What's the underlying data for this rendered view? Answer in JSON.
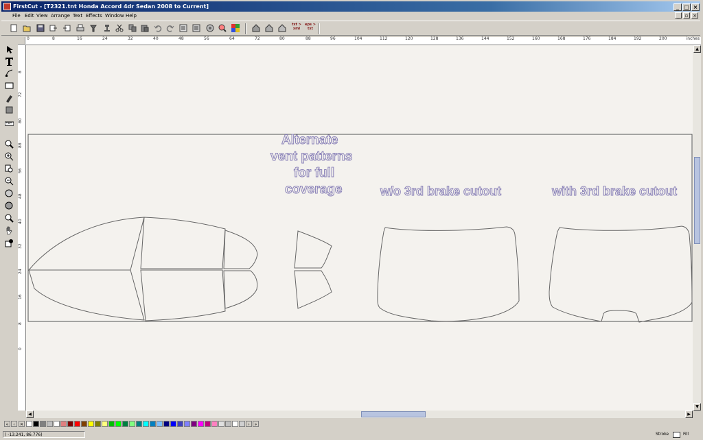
{
  "window": {
    "app_name": "FirstCut",
    "title": "FirstCut - [T2321.tnt Honda Accord 4dr Sedan 2008 to Current]"
  },
  "menu": {
    "items": [
      "File",
      "Edit",
      "View",
      "Arrange",
      "Text",
      "Effects",
      "Window",
      "Help"
    ]
  },
  "toolbar": {
    "buttons": [
      "new-document-icon",
      "open-icon",
      "save-icon",
      "import-icon",
      "export-icon",
      "print-icon",
      "pen-cut-icon",
      "plot-icon",
      "cut-icon",
      "copy-icon",
      "paste-icon",
      "undo-icon",
      "redo-icon",
      "properties-icon",
      "layers-icon",
      "color-wheel-icon",
      "zoom-to-selection-icon",
      "color-palette-icon",
      "house-icon",
      "house-icon",
      "house-icon",
      "house-icon"
    ],
    "convert_txt_xml": "txt > xml",
    "convert_eps_txt": "eps > txt"
  },
  "ruler": {
    "units": "inches",
    "h_labels": [
      "0",
      "8",
      "16",
      "24",
      "32",
      "40",
      "48",
      "56",
      "64",
      "72",
      "80",
      "88",
      "96",
      "104",
      "112",
      "120",
      "128",
      "136",
      "144",
      "152",
      "160",
      "168",
      "176",
      "184",
      "192",
      "200"
    ],
    "v_labels": [
      "8",
      "72",
      "80",
      "88",
      "56",
      "48",
      "40",
      "32",
      "24",
      "16",
      "8",
      "0"
    ]
  },
  "canvas": {
    "text_alternate": [
      "Alternate",
      "vent patterns",
      "for full",
      "coverage"
    ],
    "text_without_brake": "w/o 3rd brake cutout",
    "text_with_brake": "with 3rd brake cutout"
  },
  "palette": {
    "colors": [
      "#ffffff",
      "#000000",
      "#808080",
      "#c0c0c0",
      "#ffffff",
      "#e08080",
      "#800000",
      "#ff0000",
      "#804000",
      "#ffff00",
      "#808000",
      "#ffff80",
      "#00c000",
      "#00ff00",
      "#008040",
      "#80ff80",
      "#008080",
      "#00ffff",
      "#0080c0",
      "#80c0ff",
      "#000080",
      "#0000ff",
      "#4040c0",
      "#8080ff",
      "#800080",
      "#ff00ff",
      "#c00080",
      "#ff80c0",
      "#e0e0e0",
      "#c0c0c0",
      "#ffffff",
      "#d0d0d0"
    ]
  },
  "status": {
    "coords": "( -13.241,   86.776)",
    "stroke_label": "Stroke",
    "fill_label": "Fill"
  }
}
